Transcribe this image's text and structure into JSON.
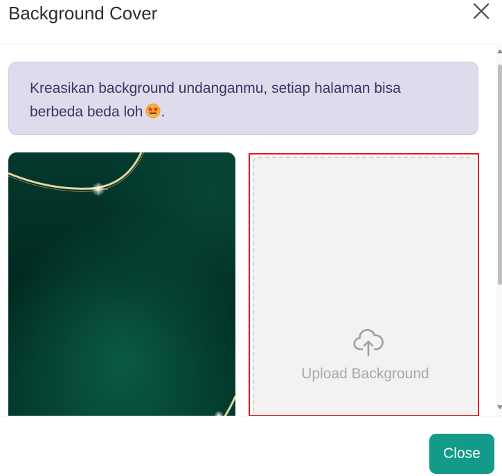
{
  "dialog": {
    "title": "Background Cover",
    "close_icon": "close-icon"
  },
  "banner": {
    "text": "Kreasikan background undanganmu, setiap halaman bisa berbeda beda loh",
    "emoji_icon": "star-struck-emoji-icon",
    "trailing": "."
  },
  "backgrounds": [
    {
      "kind": "image",
      "description_icon": "dark-green-gold-line-background",
      "colors": {
        "base": "#03382c",
        "dark": "#01241c",
        "glow": "#0a5a45",
        "line": "#e9d7a8"
      }
    }
  ],
  "upload": {
    "label": "Upload Background",
    "icon": "cloud-upload-icon"
  },
  "footer": {
    "close_label": "Close"
  },
  "colors": {
    "accent": "#149a88",
    "banner_bg": "#dfdbec",
    "banner_text": "#3a3560",
    "selection_border": "#e8141c"
  }
}
